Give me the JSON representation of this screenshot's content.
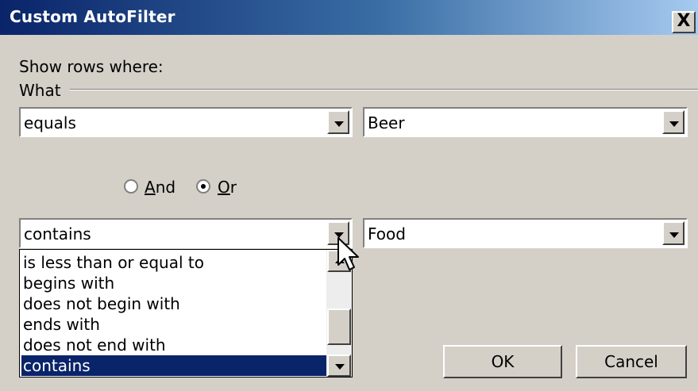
{
  "window": {
    "title": "Custom AutoFilter",
    "close_label": "X"
  },
  "prompt": "Show rows where:",
  "group_label": "What",
  "row1": {
    "operator": "equals",
    "value": "Beer"
  },
  "logic": {
    "and": {
      "label_accel": "A",
      "label_rest": "nd",
      "selected": false
    },
    "or": {
      "label_accel": "O",
      "label_rest": "r",
      "selected": true
    }
  },
  "row2": {
    "operator": "contains",
    "value": "Food"
  },
  "operator_list": {
    "options": [
      "is less than or equal to",
      "begins with",
      "does not begin with",
      "ends with",
      "does not end with",
      "contains"
    ],
    "selected": "contains"
  },
  "buttons": {
    "ok": "OK",
    "cancel": "Cancel"
  },
  "colors": {
    "title_gradient_start": "#0a246a",
    "title_gradient_end": "#a6caf0",
    "face": "#d4d0c8",
    "selection": "#0a246a"
  },
  "icons": {
    "pointer": "mouse-pointer-icon"
  }
}
